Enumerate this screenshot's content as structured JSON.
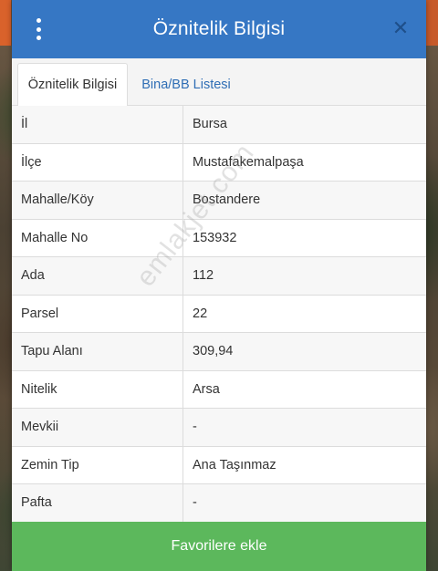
{
  "dialog": {
    "title": "Öznitelik Bilgisi"
  },
  "tabs": [
    {
      "label": "Öznitelik Bilgisi",
      "active": true
    },
    {
      "label": "Bina/BB Listesi",
      "active": false
    }
  ],
  "rows": [
    {
      "key": "İl",
      "value": "Bursa"
    },
    {
      "key": "İlçe",
      "value": "Mustafakemalpaşa"
    },
    {
      "key": "Mahalle/Köy",
      "value": "Bostandere"
    },
    {
      "key": "Mahalle No",
      "value": "153932"
    },
    {
      "key": "Ada",
      "value": "112"
    },
    {
      "key": "Parsel",
      "value": "22"
    },
    {
      "key": "Tapu Alanı",
      "value": "309,94"
    },
    {
      "key": "Nitelik",
      "value": "Arsa"
    },
    {
      "key": "Mevkii",
      "value": "-"
    },
    {
      "key": "Zemin Tip",
      "value": "Ana Taşınmaz"
    },
    {
      "key": "Pafta",
      "value": "-"
    }
  ],
  "watermark": "emlakjet.com",
  "footer": {
    "favorite_label": "Favorilere ekle"
  },
  "colors": {
    "header": "#3677c4",
    "button": "#5cb85c",
    "tab_link": "#2f6eb5"
  },
  "icons": {
    "menu": "more-vertical-icon",
    "close": "close-icon"
  }
}
